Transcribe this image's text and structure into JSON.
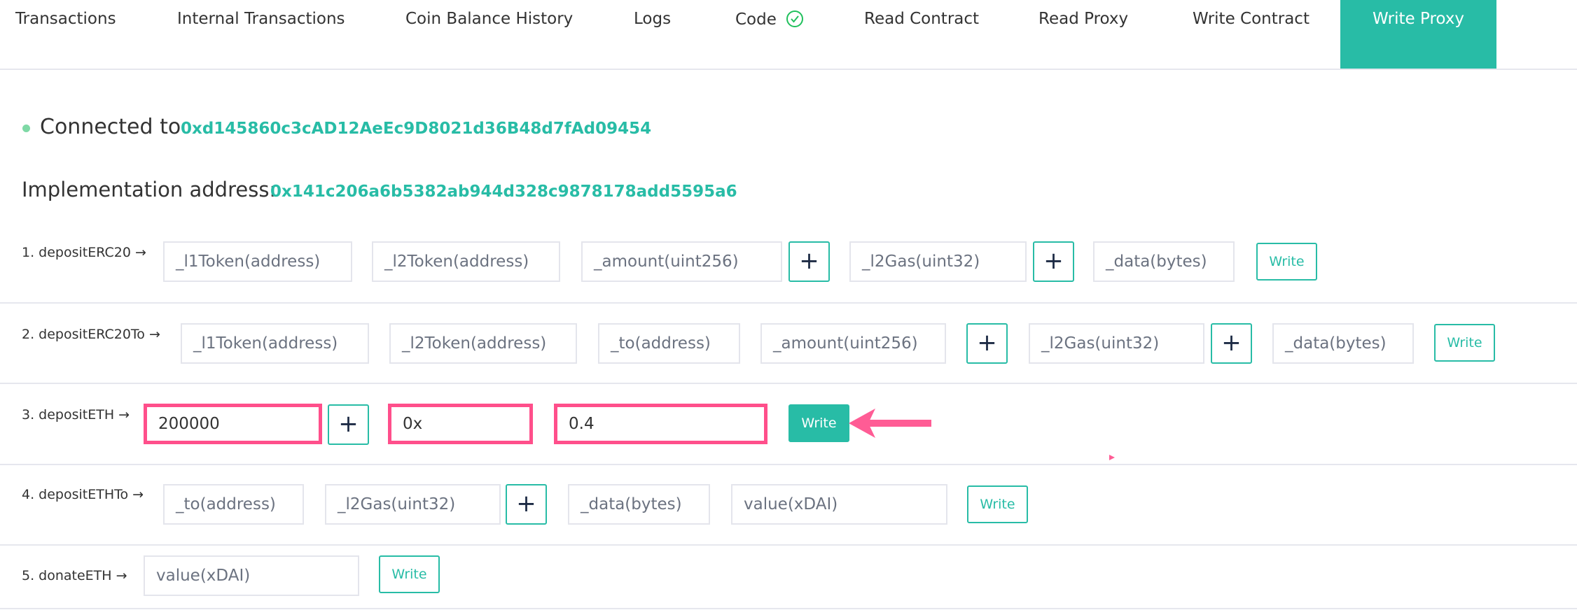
{
  "tabs": [
    "Transactions",
    "Internal Transactions",
    "Coin Balance History",
    "Logs",
    "Code",
    "Read Contract",
    "Read Proxy",
    "Write Contract",
    "Write Proxy"
  ],
  "active_tab": "Write Proxy",
  "connection": {
    "label": "Connected to",
    "address": "0xd145860c3cAD12AeEc9D8021d36B48d7fAd09454"
  },
  "implementation": {
    "label": "Implementation address:",
    "address": "0x141c206a6b5382ab944d328c9878178add5595a6"
  },
  "plus_label": "+",
  "write_label": "Write",
  "methods": [
    {
      "label": "1. depositERC20 →",
      "inputs": [
        "_l1Token(address)",
        "_l2Token(address)",
        "_amount(uint256)",
        "_l2Gas(uint32)",
        "_data(bytes)"
      ]
    },
    {
      "label": "2. depositERC20To →",
      "inputs": [
        "_l1Token(address)",
        "_l2Token(address)",
        "_to(address)",
        "_amount(uint256)",
        "_l2Gas(uint32)",
        "_data(bytes)"
      ]
    },
    {
      "label": "3. depositETH →",
      "values": [
        "200000",
        "0x",
        "0.4"
      ]
    },
    {
      "label": "4. depositETHTo →",
      "inputs": [
        "_to(address)",
        "_l2Gas(uint32)",
        "_data(bytes)",
        "value(xDAI)"
      ]
    },
    {
      "label": "5. donateETH →",
      "inputs": [
        "value(xDAI)"
      ]
    }
  ],
  "colors": {
    "accent": "#28bca6",
    "highlight": "#ff4f8b"
  }
}
